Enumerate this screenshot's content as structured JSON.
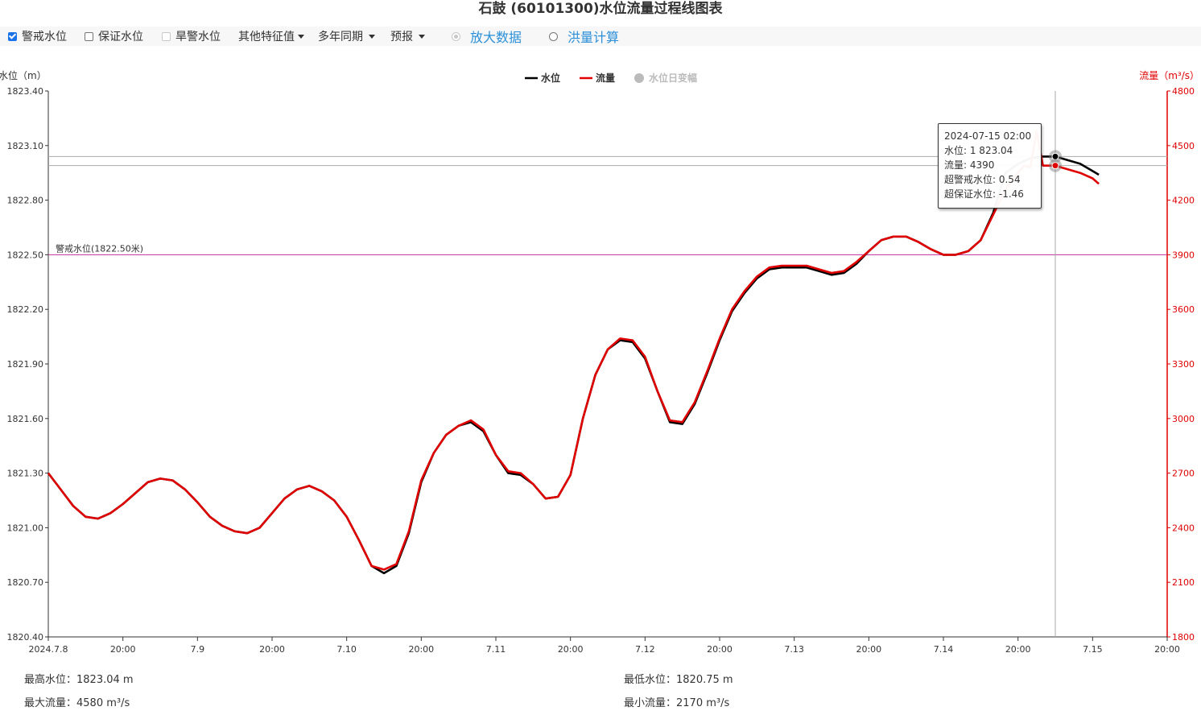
{
  "title": "石鼓 (60101300)水位流量过程线图表",
  "toolbar": {
    "warning_level": {
      "label": "警戒水位",
      "checked": true
    },
    "guarantee_level": {
      "label": "保证水位",
      "checked": false
    },
    "drought_level": {
      "label": "旱警水位",
      "checked": false
    },
    "other_features": "其他特征值",
    "multi_year": "多年同期",
    "forecast": "预报",
    "zoom_data": "放大数据",
    "flood_calc": "洪量计算"
  },
  "tooltip": {
    "time": "2024-07-15 02:00",
    "level": "水位: 1 823.04",
    "flow": "流量: 4390",
    "over_warning": "超警戒水位: 0.54",
    "over_guarantee": "超保证水位: -1.46"
  },
  "stats": {
    "max_level": "最高水位：1823.04  m",
    "min_level": "最低水位：1820.75  m",
    "max_flow": "最大流量：4580 m³/s",
    "min_flow": "最小流量：2170 m³/s"
  },
  "chart_data": {
    "type": "line",
    "ylabel_left": "水位（m）",
    "ylabel_right": "流量（m³/s）",
    "ylim_left": [
      1820.4,
      1823.4
    ],
    "ylim_right": [
      1800,
      4800
    ],
    "yticks_left": [
      "1823.40",
      "1823.10",
      "1822.80",
      "1822.50",
      "1822.20",
      "1821.90",
      "1821.60",
      "1821.30",
      "1821.00",
      "1820.70",
      "1820.40"
    ],
    "yticks_right": [
      "4800",
      "4500",
      "4200",
      "3900",
      "3600",
      "3300",
      "3000",
      "2700",
      "2400",
      "2100",
      "1800"
    ],
    "xlim_hours": [
      0,
      180
    ],
    "xticks": [
      {
        "h": 0,
        "label": "2024.7.8"
      },
      {
        "h": 12,
        "label": "20:00"
      },
      {
        "h": 24,
        "label": "7.9"
      },
      {
        "h": 36,
        "label": "20:00"
      },
      {
        "h": 48,
        "label": "7.10"
      },
      {
        "h": 60,
        "label": "20:00"
      },
      {
        "h": 72,
        "label": "7.11"
      },
      {
        "h": 84,
        "label": "20:00"
      },
      {
        "h": 96,
        "label": "7.12"
      },
      {
        "h": 108,
        "label": "20:00"
      },
      {
        "h": 120,
        "label": "7.13"
      },
      {
        "h": 132,
        "label": "20:00"
      },
      {
        "h": 144,
        "label": "7.14"
      },
      {
        "h": 156,
        "label": "20:00"
      },
      {
        "h": 168,
        "label": "7.15"
      },
      {
        "h": 180,
        "label": "20:00"
      }
    ],
    "legend": [
      {
        "name": "水位",
        "color": "#000000"
      },
      {
        "name": "流量",
        "color": "#e00000"
      },
      {
        "name": "水位日变幅",
        "color": "#bbbbbb"
      }
    ],
    "warning_line": {
      "label": "警戒水位(1822.50米)",
      "value": 1822.5,
      "color": "#c0309a"
    },
    "crosshair_hour": 162,
    "series": [
      {
        "name": "水位",
        "color": "#000000",
        "axis": "left",
        "x": [
          0,
          2,
          4,
          6,
          8,
          10,
          12,
          14,
          16,
          18,
          20,
          22,
          24,
          26,
          28,
          30,
          32,
          34,
          36,
          38,
          40,
          42,
          44,
          46,
          48,
          50,
          52,
          54,
          56,
          58,
          60,
          62,
          64,
          66,
          68,
          70,
          72,
          74,
          76,
          78,
          80,
          82,
          84,
          86,
          88,
          90,
          92,
          94,
          96,
          98,
          100,
          102,
          104,
          106,
          108,
          110,
          112,
          114,
          116,
          118,
          120,
          122,
          124,
          126,
          128,
          130,
          132,
          134,
          136,
          138,
          140,
          142,
          144,
          146,
          148,
          150,
          152,
          154,
          156,
          158,
          160,
          162,
          164,
          166,
          168,
          169
        ],
        "y": [
          1821.3,
          1821.21,
          1821.12,
          1821.06,
          1821.05,
          1821.08,
          1821.13,
          1821.19,
          1821.25,
          1821.27,
          1821.26,
          1821.21,
          1821.14,
          1821.06,
          1821.01,
          1820.98,
          1820.97,
          1821.0,
          1821.08,
          1821.16,
          1821.21,
          1821.23,
          1821.2,
          1821.15,
          1821.06,
          1820.93,
          1820.79,
          1820.75,
          1820.79,
          1820.97,
          1821.25,
          1821.41,
          1821.51,
          1821.56,
          1821.58,
          1821.53,
          1821.4,
          1821.3,
          1821.29,
          1821.24,
          1821.16,
          1821.17,
          1821.29,
          1821.6,
          1821.84,
          1821.98,
          1822.03,
          1822.02,
          1821.93,
          1821.75,
          1821.58,
          1821.57,
          1821.68,
          1821.85,
          1822.03,
          1822.19,
          1822.29,
          1822.37,
          1822.42,
          1822.43,
          1822.43,
          1822.43,
          1822.41,
          1822.39,
          1822.4,
          1822.45,
          1822.52,
          1822.58,
          1822.6,
          1822.6,
          1822.57,
          1822.53,
          1822.5,
          1822.5,
          1822.52,
          1822.58,
          1822.73,
          1822.95,
          1823.0,
          1823.03,
          1823.04,
          1823.04,
          1823.02,
          1823.0,
          1822.96,
          1822.94
        ]
      },
      {
        "name": "流量",
        "color": "#e00000",
        "axis": "right",
        "x": [
          0,
          2,
          4,
          6,
          8,
          10,
          12,
          14,
          16,
          18,
          20,
          22,
          24,
          26,
          28,
          30,
          32,
          34,
          36,
          38,
          40,
          42,
          44,
          46,
          48,
          50,
          52,
          54,
          56,
          58,
          60,
          62,
          64,
          66,
          68,
          70,
          72,
          74,
          76,
          78,
          80,
          82,
          84,
          86,
          88,
          90,
          92,
          94,
          96,
          98,
          100,
          102,
          104,
          106,
          108,
          110,
          112,
          114,
          116,
          118,
          120,
          122,
          124,
          126,
          128,
          130,
          132,
          134,
          136,
          138,
          140,
          142,
          144,
          146,
          148,
          150,
          152,
          154,
          156,
          157,
          158,
          159,
          160,
          161,
          162,
          164,
          166,
          168,
          169
        ],
        "y": [
          2700,
          2610,
          2520,
          2460,
          2450,
          2480,
          2530,
          2590,
          2650,
          2670,
          2660,
          2610,
          2540,
          2460,
          2410,
          2380,
          2370,
          2400,
          2480,
          2560,
          2610,
          2630,
          2600,
          2550,
          2460,
          2330,
          2190,
          2170,
          2200,
          2380,
          2660,
          2810,
          2910,
          2960,
          2990,
          2940,
          2800,
          2710,
          2700,
          2640,
          2560,
          2570,
          2690,
          3000,
          3240,
          3380,
          3440,
          3430,
          3340,
          3150,
          2990,
          2980,
          3090,
          3260,
          3440,
          3600,
          3700,
          3780,
          3830,
          3840,
          3840,
          3840,
          3820,
          3800,
          3810,
          3860,
          3920,
          3980,
          4000,
          4000,
          3970,
          3930,
          3900,
          3900,
          3920,
          3980,
          4120,
          4260,
          4350,
          4390,
          4380,
          4580,
          4390,
          4390,
          4390,
          4370,
          4350,
          4320,
          4290
        ]
      }
    ]
  }
}
